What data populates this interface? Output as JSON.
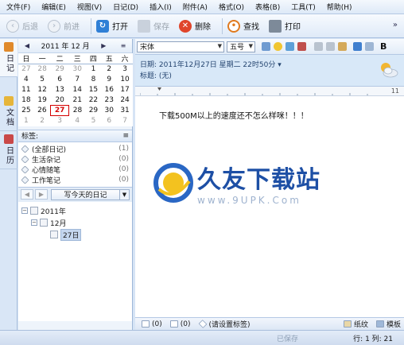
{
  "menu": [
    "文件(F)",
    "编辑(E)",
    "视图(V)",
    "日记(D)",
    "插入(I)",
    "附件(A)",
    "格式(O)",
    "表格(B)",
    "工具(T)",
    "帮助(H)"
  ],
  "toolbar": {
    "back": "后退",
    "forward": "前进",
    "open": "打开",
    "save": "保存",
    "delete": "删除",
    "find": "查找",
    "print": "打印",
    "more": "»"
  },
  "vtabs": {
    "diary": "日记",
    "docs": "文档",
    "calendar": "日历"
  },
  "calendar": {
    "title": "2011 年  12 月",
    "weekdays": [
      "日",
      "一",
      "二",
      "三",
      "四",
      "五",
      "六"
    ],
    "weeks": [
      [
        {
          "d": "27",
          "o": true
        },
        {
          "d": "28",
          "o": true
        },
        {
          "d": "29",
          "o": true
        },
        {
          "d": "30",
          "o": true
        },
        {
          "d": "1"
        },
        {
          "d": "2"
        },
        {
          "d": "3"
        }
      ],
      [
        {
          "d": "4"
        },
        {
          "d": "5"
        },
        {
          "d": "6"
        },
        {
          "d": "7"
        },
        {
          "d": "8"
        },
        {
          "d": "9"
        },
        {
          "d": "10"
        }
      ],
      [
        {
          "d": "11"
        },
        {
          "d": "12"
        },
        {
          "d": "13"
        },
        {
          "d": "14"
        },
        {
          "d": "15"
        },
        {
          "d": "16"
        },
        {
          "d": "17"
        }
      ],
      [
        {
          "d": "18"
        },
        {
          "d": "19"
        },
        {
          "d": "20"
        },
        {
          "d": "21"
        },
        {
          "d": "22"
        },
        {
          "d": "23"
        },
        {
          "d": "24"
        }
      ],
      [
        {
          "d": "25"
        },
        {
          "d": "26"
        },
        {
          "d": "27",
          "t": true
        },
        {
          "d": "28"
        },
        {
          "d": "29"
        },
        {
          "d": "30"
        },
        {
          "d": "31"
        }
      ],
      [
        {
          "d": "1",
          "o": true
        },
        {
          "d": "2",
          "o": true
        },
        {
          "d": "3",
          "o": true
        },
        {
          "d": "4",
          "o": true
        },
        {
          "d": "5",
          "o": true
        },
        {
          "d": "6",
          "o": true
        },
        {
          "d": "7",
          "o": true
        }
      ]
    ]
  },
  "tags": {
    "header": "标签:",
    "items": [
      {
        "name": "(全部日记)",
        "count": "(1)"
      },
      {
        "name": "生活杂记",
        "count": "(0)"
      },
      {
        "name": "心情随笔",
        "count": "(0)"
      },
      {
        "name": "工作笔记",
        "count": "(0)"
      }
    ]
  },
  "nav": {
    "write_today": "写今天的日记"
  },
  "tree": {
    "year": "2011年",
    "month": "12月",
    "day": "27日"
  },
  "editor": {
    "font": "宋体",
    "size": "五号",
    "date_line": "日期:  2011年12月27日  星期二  22时50分  ▾",
    "title_line": "标题:  (无)",
    "ruler_end": "11",
    "content": "下载500M以上的速度还不怎么样咪！！！",
    "status_attach": "(0)",
    "status_comment": "(0)",
    "status_tag": "(请设置标签)",
    "status_paper": "纸纹",
    "status_template": "模板"
  },
  "watermark": {
    "title": "久友下载站",
    "url": "www.9UPK.Com"
  },
  "statusbar": {
    "saved": "已保存",
    "position": "行:  1   列:  21"
  },
  "colors": {
    "accent": "#1d4fa5",
    "today": "#d40000",
    "info_bg": "#d8e8f8"
  }
}
